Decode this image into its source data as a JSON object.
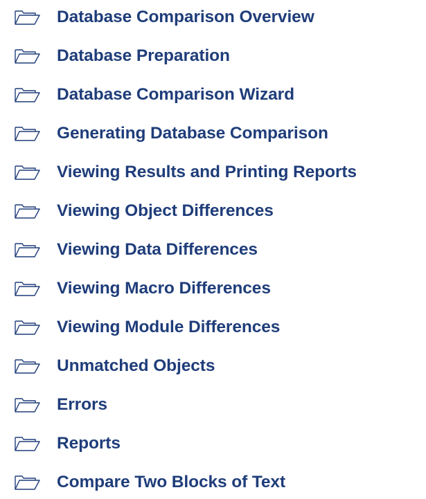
{
  "toc": {
    "items": [
      {
        "label": "Database Comparison Overview",
        "icon": "folder-open-icon"
      },
      {
        "label": "Database Preparation",
        "icon": "folder-open-icon"
      },
      {
        "label": "Database Comparison Wizard",
        "icon": "folder-open-icon"
      },
      {
        "label": "Generating Database Comparison",
        "icon": "folder-open-icon"
      },
      {
        "label": "Viewing Results and Printing Reports",
        "icon": "folder-open-icon"
      },
      {
        "label": "Viewing Object Differences",
        "icon": "folder-open-icon"
      },
      {
        "label": "Viewing Data Differences",
        "icon": "folder-open-icon"
      },
      {
        "label": "Viewing Macro Differences",
        "icon": "folder-open-icon"
      },
      {
        "label": "Viewing Module Differences",
        "icon": "folder-open-icon"
      },
      {
        "label": "Unmatched Objects",
        "icon": "folder-open-icon"
      },
      {
        "label": "Errors",
        "icon": "folder-open-icon"
      },
      {
        "label": "Reports",
        "icon": "folder-open-icon"
      },
      {
        "label": "Compare Two Blocks of Text",
        "icon": "folder-open-icon"
      }
    ]
  },
  "colors": {
    "link": "#1f3d7a",
    "icon_stroke": "#1f3d7a",
    "background": "#ffffff"
  }
}
